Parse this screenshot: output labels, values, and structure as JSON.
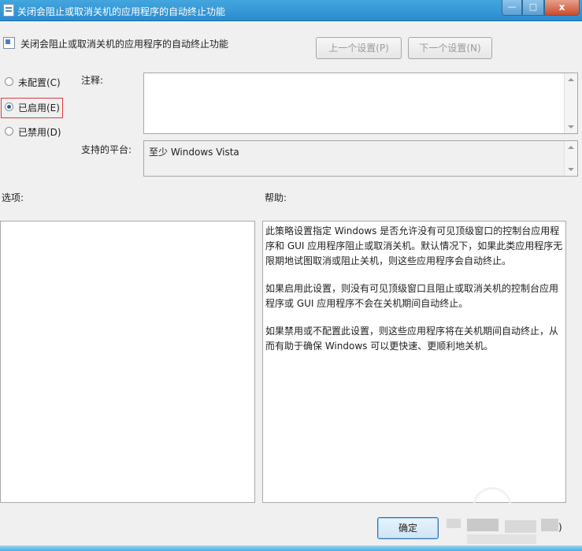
{
  "window": {
    "title": "关闭会阻止或取消关机的应用程序的自动终止功能",
    "controls": {
      "minimize": "—",
      "maximize": "□",
      "close": "x"
    }
  },
  "header": {
    "policy_name": "关闭会阻止或取消关机的应用程序的自动终止功能",
    "prev_button": "上一个设置(P)",
    "next_button": "下一个设置(N)"
  },
  "options": {
    "not_configured": "未配置(C)",
    "enabled": "已启用(E)",
    "disabled": "已禁用(D)",
    "selected": "enabled"
  },
  "comment": {
    "label": "注释:",
    "value": ""
  },
  "platform": {
    "label": "支持的平台:",
    "value": "至少 Windows Vista"
  },
  "sections": {
    "options_label": "选项:",
    "help_label": "帮助:"
  },
  "help": {
    "paragraphs": [
      "此策略设置指定 Windows 是否允许没有可见顶级窗口的控制台应用程序和 GUI 应用程序阻止或取消关机。默认情况下，如果此类应用程序无限期地试图取消或阻止关机，则这些应用程序会自动终止。",
      "如果启用此设置，则没有可见顶级窗口且阻止或取消关机的控制台应用程序或 GUI 应用程序不会在关机期间自动终止。",
      "如果禁用或不配置此设置，则这些应用程序将在关机期间自动终止，从而有助于确保 Windows 可以更快速、更顺利地关机。"
    ]
  },
  "footer": {
    "ok_button": "确定",
    "partial_button": ")"
  }
}
